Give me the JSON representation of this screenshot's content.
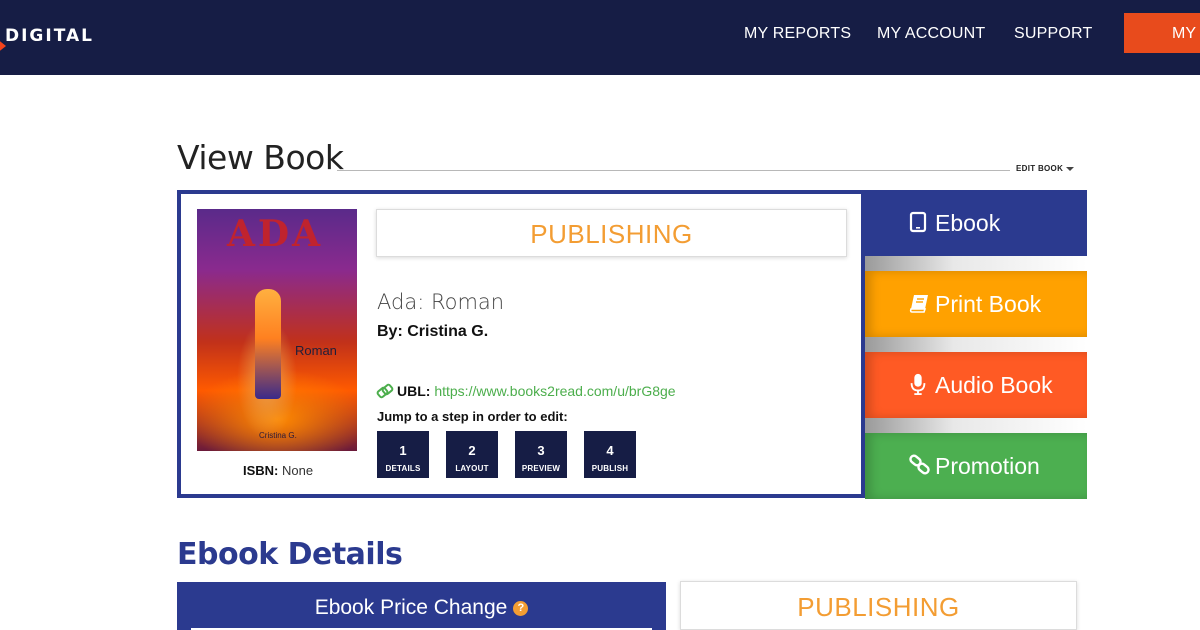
{
  "nav": {
    "logo": "DIGITAL",
    "links": [
      "MY REPORTS",
      "MY ACCOUNT",
      "SUPPORT"
    ],
    "cta": "MY B"
  },
  "page": {
    "title": "View Book",
    "edit_book": "EDIT BOOK"
  },
  "book": {
    "cover_title": "ADA",
    "cover_subtitle": "Roman",
    "cover_author": "Cristina G.",
    "isbn_label": "ISBN:",
    "isbn_value": "None",
    "status": "PUBLISHING",
    "title": "Ada: Roman",
    "author": "By: Cristina G.",
    "ubl_label": "UBL:",
    "ubl_url": "https://www.books2read.com/u/brG8ge",
    "jump_text": "Jump to a step in order to edit:",
    "steps": [
      {
        "num": "1",
        "label": "DETAILS"
      },
      {
        "num": "2",
        "label": "LAYOUT"
      },
      {
        "num": "3",
        "label": "PREVIEW"
      },
      {
        "num": "4",
        "label": "PUBLISH"
      }
    ]
  },
  "side_tabs": [
    {
      "label": "Ebook",
      "icon": "tablet-icon",
      "color": "#2b3a8f"
    },
    {
      "label": "Print Book",
      "icon": "book-icon",
      "color": "#ffa100"
    },
    {
      "label": "Audio Book",
      "icon": "microphone-icon",
      "color": "#ff5a24"
    },
    {
      "label": "Promotion",
      "icon": "link-icon",
      "color": "#4caf50"
    }
  ],
  "details": {
    "title": "Ebook Details",
    "price_change": "Ebook Price Change",
    "help": "?",
    "status": "PUBLISHING"
  },
  "colors": {
    "navy": "#161d45",
    "brand_blue": "#2b3a8f",
    "accent_orange": "#f39d33",
    "cta_red": "#e84b1c"
  }
}
